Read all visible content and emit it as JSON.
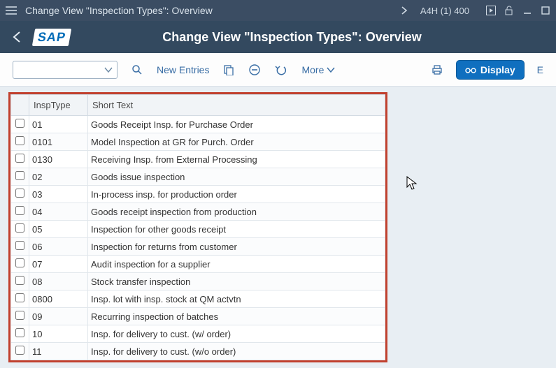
{
  "titlebar": {
    "title": "Change View \"Inspection Types\": Overview",
    "system": "A4H (1) 400"
  },
  "header": {
    "page_title": "Change View \"Inspection Types\": Overview"
  },
  "toolbar": {
    "new_entries": "New Entries",
    "more": "More",
    "display": "Display",
    "exit": "E"
  },
  "grid": {
    "columns": {
      "insp": "InspType",
      "short": "Short Text"
    },
    "rows": [
      {
        "code": "01",
        "text": "Goods Receipt Insp. for Purchase Order"
      },
      {
        "code": "0101",
        "text": "Model Inspection at GR for Purch. Order"
      },
      {
        "code": "0130",
        "text": "Receiving Insp. from External Processing"
      },
      {
        "code": "02",
        "text": "Goods issue inspection"
      },
      {
        "code": "03",
        "text": "In-process insp. for production order"
      },
      {
        "code": "04",
        "text": "Goods receipt inspection from production"
      },
      {
        "code": "05",
        "text": "Inspection for other goods receipt"
      },
      {
        "code": "06",
        "text": "Inspection for returns from customer"
      },
      {
        "code": "07",
        "text": "Audit inspection for a supplier"
      },
      {
        "code": "08",
        "text": "Stock transfer inspection"
      },
      {
        "code": "0800",
        "text": "Insp. lot with insp. stock at QM actvtn"
      },
      {
        "code": "09",
        "text": "Recurring inspection of batches"
      },
      {
        "code": "10",
        "text": "Insp. for delivery to cust. (w/ order)"
      },
      {
        "code": "11",
        "text": "Insp. for delivery to cust. (w/o order)"
      }
    ]
  }
}
